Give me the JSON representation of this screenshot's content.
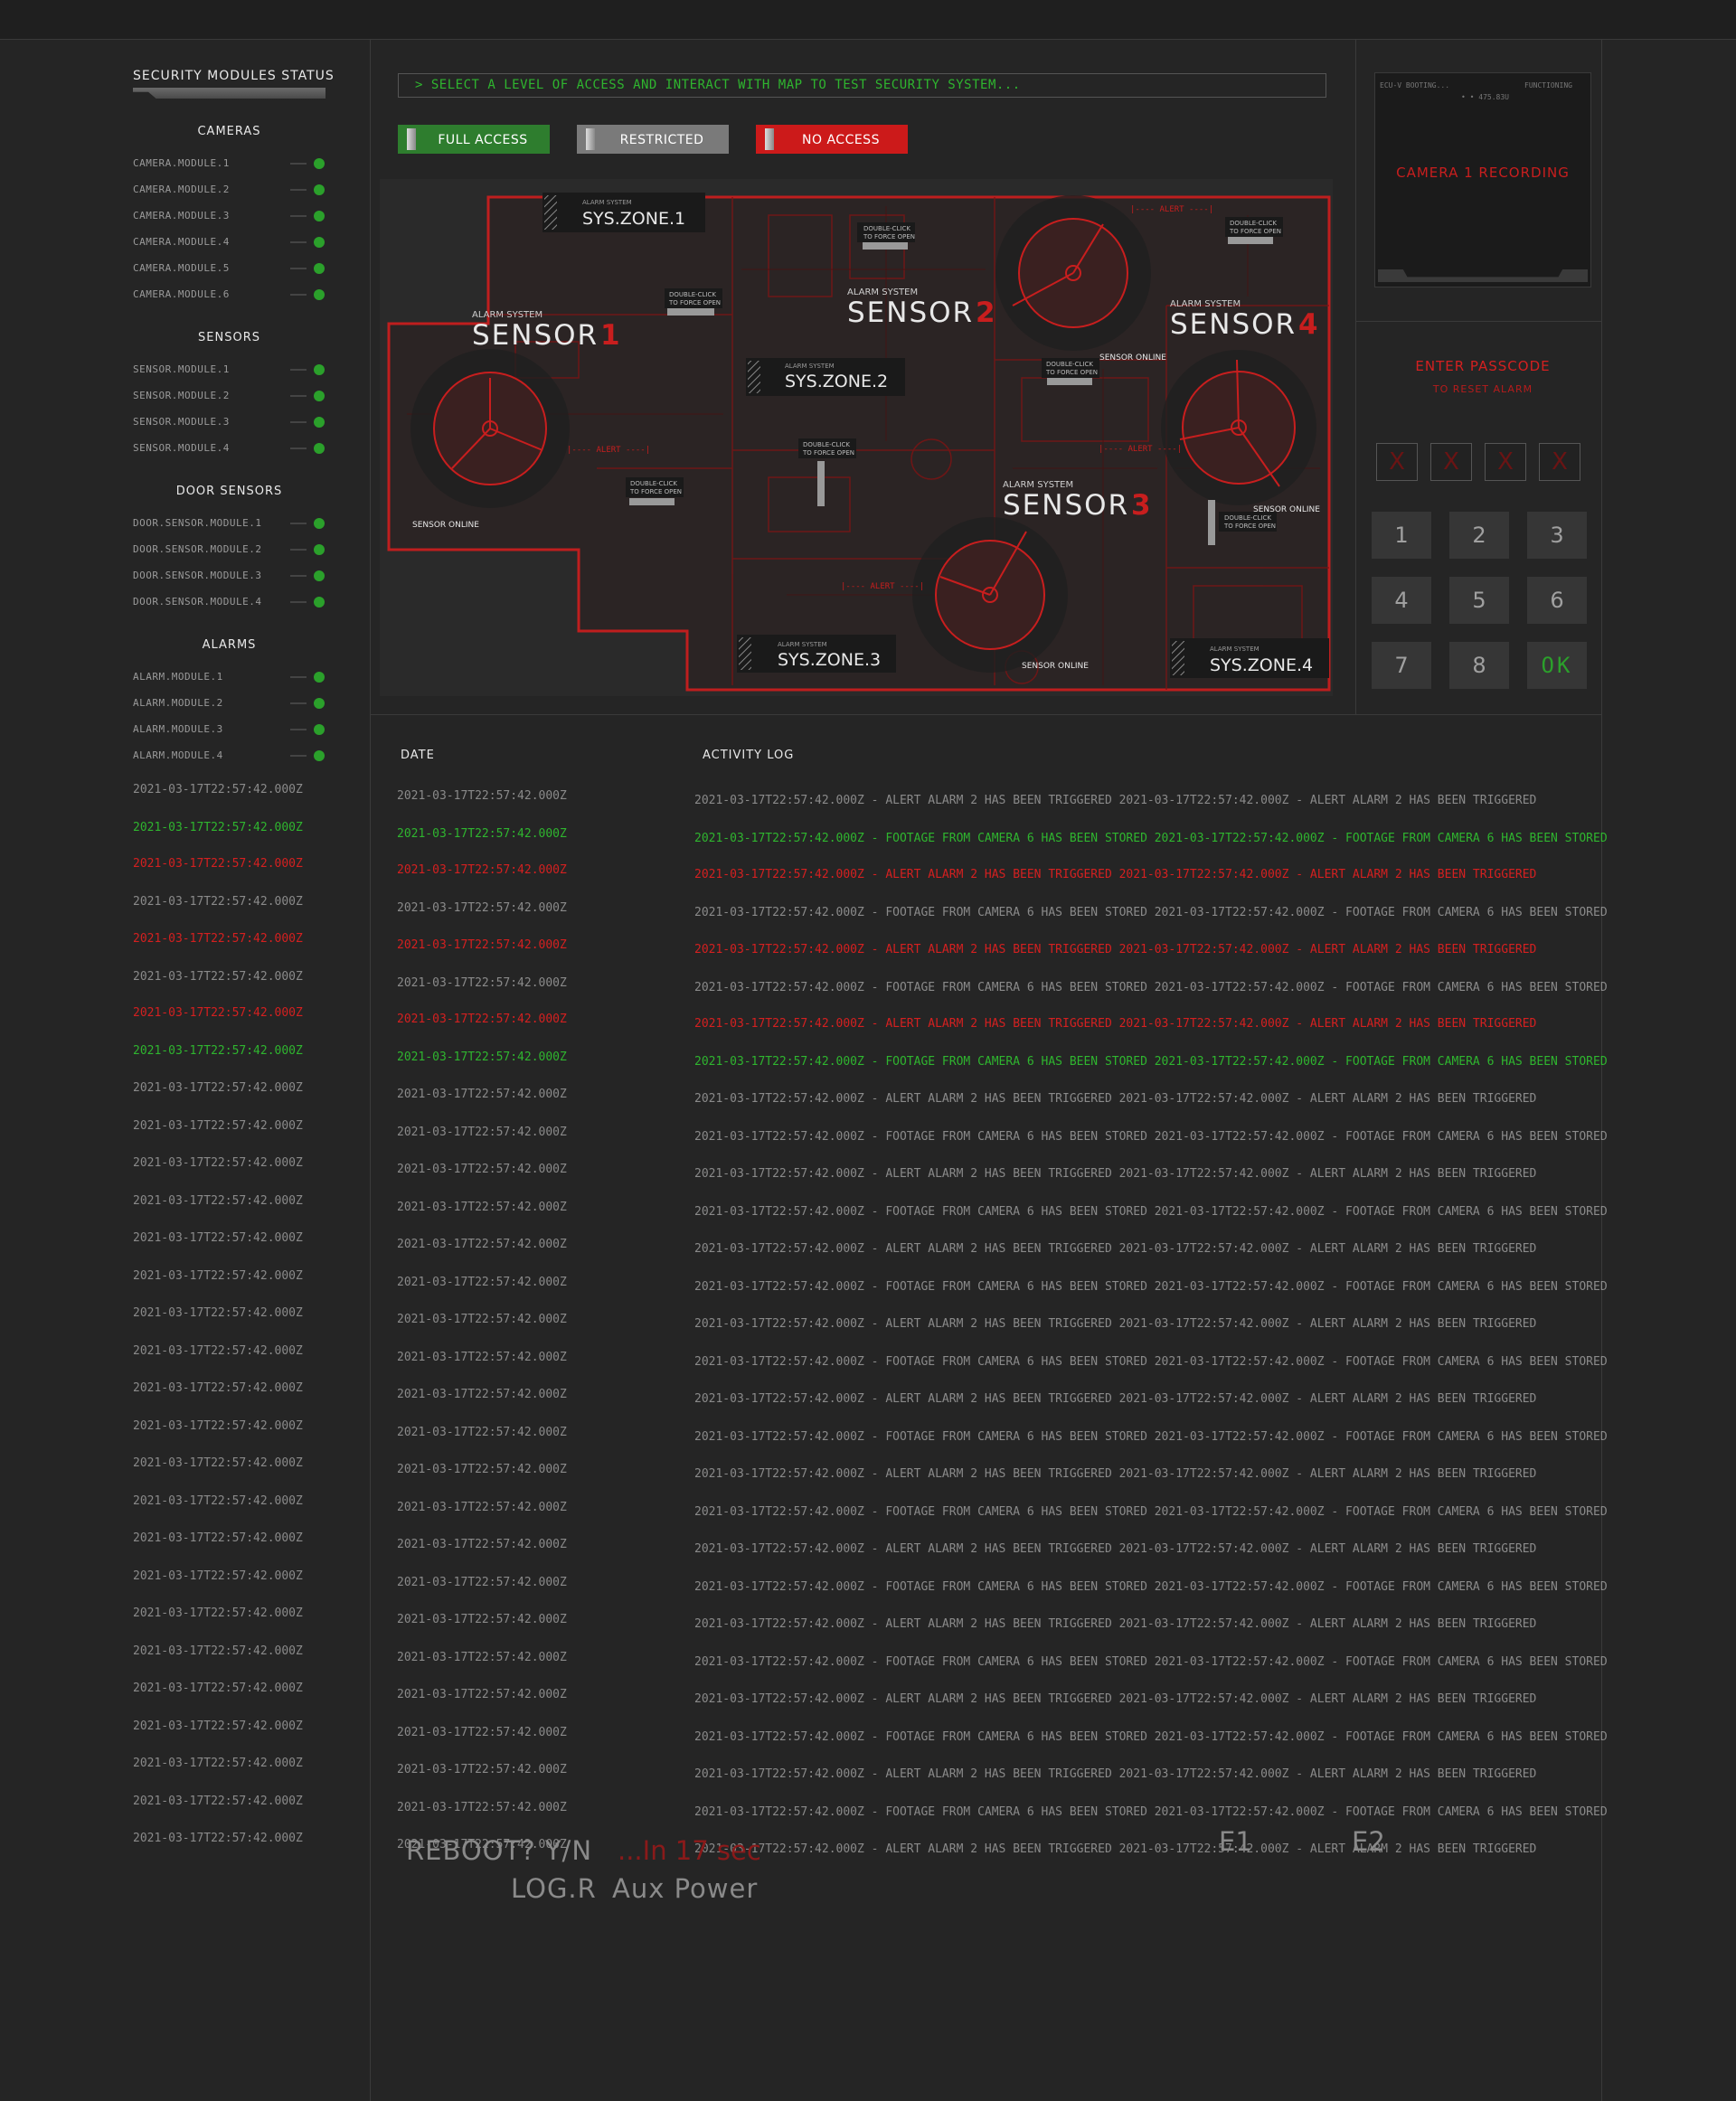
{
  "sidebar": {
    "title": "SECURITY MODULES STATUS",
    "groups": [
      {
        "title": "CAMERAS",
        "items": [
          "CAMERA.MODULE.1",
          "CAMERA.MODULE.2",
          "CAMERA.MODULE.3",
          "CAMERA.MODULE.4",
          "CAMERA.MODULE.5",
          "CAMERA.MODULE.6"
        ]
      },
      {
        "title": "SENSORS",
        "items": [
          "SENSOR.MODULE.1",
          "SENSOR.MODULE.2",
          "SENSOR.MODULE.3",
          "SENSOR.MODULE.4"
        ]
      },
      {
        "title": "DOOR SENSORS",
        "items": [
          "DOOR.SENSOR.MODULE.1",
          "DOOR.SENSOR.MODULE.2",
          "DOOR.SENSOR.MODULE.3",
          "DOOR.SENSOR.MODULE.4"
        ]
      },
      {
        "title": "ALARMS",
        "items": [
          "ALARM.MODULE.1",
          "ALARM.MODULE.2",
          "ALARM.MODULE.3",
          "ALARM.MODULE.4"
        ]
      }
    ],
    "status_color": "#2ba02b",
    "date": "2021-03-17T22:57:42.000Z"
  },
  "instruction": "> SELECT A LEVEL OF ACCESS AND INTERACT WITH MAP TO TEST SECURITY SYSTEM...",
  "access_buttons": [
    {
      "label": "FULL ACCESS",
      "color": "#2e7d2e"
    },
    {
      "label": "RESTRICTED",
      "color": "#7a7a7a"
    },
    {
      "label": "NO ACCESS",
      "color": "#cc1a1a"
    }
  ],
  "map": {
    "zones": [
      "SYS.ZONE.1",
      "SYS.ZONE.2",
      "SYS.ZONE.3",
      "SYS.ZONE.4"
    ],
    "zone_caption": "ALARM SYSTEM",
    "sensor_caption": "ALARM SYSTEM",
    "sensor_word": "SENSOR",
    "sensor_numbers": [
      "1",
      "2",
      "3",
      "4"
    ],
    "sensor_online": "SENSOR ONLINE",
    "double_click": "DOUBLE-CLICK",
    "force_open": "TO FORCE OPEN",
    "alert": "|---- ALERT ----|",
    "accent": "#c81e1e"
  },
  "camera": {
    "status_left": "ECU-V BOOTING...",
    "status_right": "FUNCTIONING",
    "readout": "• • 475.83U",
    "recording": "CAMERA 1 RECORDING"
  },
  "passcode": {
    "title": "ENTER PASSCODE",
    "subtitle": "TO RESET ALARM",
    "slots": [
      "X",
      "X",
      "X",
      "X"
    ],
    "keys": [
      "1",
      "2",
      "3",
      "4",
      "5",
      "6",
      "7",
      "8",
      "OK"
    ]
  },
  "log": {
    "date_header": "DATE",
    "activity_header": "ACTIVITY LOG",
    "rows": [
      {
        "date": "2021-03-17T22:57:42.000Z",
        "text": "2021-03-17T22:57:42.000Z - ALERT ALARM 2 HAS BEEN TRIGGERED 2021-03-17T22:57:42.000Z - ALERT ALARM 2 HAS BEEN TRIGGERED",
        "status": ""
      },
      {
        "date": "2021-03-17T22:57:42.000Z",
        "text": "2021-03-17T22:57:42.000Z - FOOTAGE FROM CAMERA 6 HAS BEEN STORED 2021-03-17T22:57:42.000Z - FOOTAGE FROM CAMERA 6 HAS BEEN STORED",
        "status": "g"
      },
      {
        "date": "2021-03-17T22:57:42.000Z",
        "text": "2021-03-17T22:57:42.000Z - ALERT ALARM 2 HAS BEEN TRIGGERED 2021-03-17T22:57:42.000Z - ALERT ALARM 2 HAS BEEN TRIGGERED",
        "status": "r"
      },
      {
        "date": "2021-03-17T22:57:42.000Z",
        "text": "2021-03-17T22:57:42.000Z - FOOTAGE FROM CAMERA 6 HAS BEEN STORED 2021-03-17T22:57:42.000Z - FOOTAGE FROM CAMERA 6 HAS BEEN STORED",
        "status": ""
      },
      {
        "date": "2021-03-17T22:57:42.000Z",
        "text": "2021-03-17T22:57:42.000Z - ALERT ALARM 2 HAS BEEN TRIGGERED 2021-03-17T22:57:42.000Z - ALERT ALARM 2 HAS BEEN TRIGGERED",
        "status": "r"
      },
      {
        "date": "2021-03-17T22:57:42.000Z",
        "text": "2021-03-17T22:57:42.000Z - FOOTAGE FROM CAMERA 6 HAS BEEN STORED 2021-03-17T22:57:42.000Z - FOOTAGE FROM CAMERA 6 HAS BEEN STORED",
        "status": ""
      },
      {
        "date": "2021-03-17T22:57:42.000Z",
        "text": "2021-03-17T22:57:42.000Z - ALERT ALARM 2 HAS BEEN TRIGGERED 2021-03-17T22:57:42.000Z - ALERT ALARM 2 HAS BEEN TRIGGERED",
        "status": "r"
      },
      {
        "date": "2021-03-17T22:57:42.000Z",
        "text": "2021-03-17T22:57:42.000Z - FOOTAGE FROM CAMERA 6 HAS BEEN STORED 2021-03-17T22:57:42.000Z - FOOTAGE FROM CAMERA 6 HAS BEEN STORED",
        "status": "g"
      },
      {
        "date": "2021-03-17T22:57:42.000Z",
        "text": "2021-03-17T22:57:42.000Z - ALERT ALARM 2 HAS BEEN TRIGGERED 2021-03-17T22:57:42.000Z - ALERT ALARM 2 HAS BEEN TRIGGERED",
        "status": ""
      },
      {
        "date": "2021-03-17T22:57:42.000Z",
        "text": "2021-03-17T22:57:42.000Z - FOOTAGE FROM CAMERA 6 HAS BEEN STORED 2021-03-17T22:57:42.000Z - FOOTAGE FROM CAMERA 6 HAS BEEN STORED",
        "status": ""
      },
      {
        "date": "2021-03-17T22:57:42.000Z",
        "text": "2021-03-17T22:57:42.000Z - ALERT ALARM 2 HAS BEEN TRIGGERED 2021-03-17T22:57:42.000Z - ALERT ALARM 2 HAS BEEN TRIGGERED",
        "status": ""
      },
      {
        "date": "2021-03-17T22:57:42.000Z",
        "text": "2021-03-17T22:57:42.000Z - FOOTAGE FROM CAMERA 6 HAS BEEN STORED 2021-03-17T22:57:42.000Z - FOOTAGE FROM CAMERA 6 HAS BEEN STORED",
        "status": ""
      },
      {
        "date": "2021-03-17T22:57:42.000Z",
        "text": "2021-03-17T22:57:42.000Z - ALERT ALARM 2 HAS BEEN TRIGGERED 2021-03-17T22:57:42.000Z - ALERT ALARM 2 HAS BEEN TRIGGERED",
        "status": ""
      },
      {
        "date": "2021-03-17T22:57:42.000Z",
        "text": "2021-03-17T22:57:42.000Z - FOOTAGE FROM CAMERA 6 HAS BEEN STORED 2021-03-17T22:57:42.000Z - FOOTAGE FROM CAMERA 6 HAS BEEN STORED",
        "status": ""
      },
      {
        "date": "2021-03-17T22:57:42.000Z",
        "text": "2021-03-17T22:57:42.000Z - ALERT ALARM 2 HAS BEEN TRIGGERED 2021-03-17T22:57:42.000Z - ALERT ALARM 2 HAS BEEN TRIGGERED",
        "status": ""
      },
      {
        "date": "2021-03-17T22:57:42.000Z",
        "text": "2021-03-17T22:57:42.000Z - FOOTAGE FROM CAMERA 6 HAS BEEN STORED 2021-03-17T22:57:42.000Z - FOOTAGE FROM CAMERA 6 HAS BEEN STORED",
        "status": ""
      },
      {
        "date": "2021-03-17T22:57:42.000Z",
        "text": "2021-03-17T22:57:42.000Z - ALERT ALARM 2 HAS BEEN TRIGGERED 2021-03-17T22:57:42.000Z - ALERT ALARM 2 HAS BEEN TRIGGERED",
        "status": ""
      },
      {
        "date": "2021-03-17T22:57:42.000Z",
        "text": "2021-03-17T22:57:42.000Z - FOOTAGE FROM CAMERA 6 HAS BEEN STORED 2021-03-17T22:57:42.000Z - FOOTAGE FROM CAMERA 6 HAS BEEN STORED",
        "status": ""
      },
      {
        "date": "2021-03-17T22:57:42.000Z",
        "text": "2021-03-17T22:57:42.000Z - ALERT ALARM 2 HAS BEEN TRIGGERED 2021-03-17T22:57:42.000Z - ALERT ALARM 2 HAS BEEN TRIGGERED",
        "status": ""
      },
      {
        "date": "2021-03-17T22:57:42.000Z",
        "text": "2021-03-17T22:57:42.000Z - FOOTAGE FROM CAMERA 6 HAS BEEN STORED 2021-03-17T22:57:42.000Z - FOOTAGE FROM CAMERA 6 HAS BEEN STORED",
        "status": ""
      },
      {
        "date": "2021-03-17T22:57:42.000Z",
        "text": "2021-03-17T22:57:42.000Z - ALERT ALARM 2 HAS BEEN TRIGGERED 2021-03-17T22:57:42.000Z - ALERT ALARM 2 HAS BEEN TRIGGERED",
        "status": ""
      },
      {
        "date": "2021-03-17T22:57:42.000Z",
        "text": "2021-03-17T22:57:42.000Z - FOOTAGE FROM CAMERA 6 HAS BEEN STORED 2021-03-17T22:57:42.000Z - FOOTAGE FROM CAMERA 6 HAS BEEN STORED",
        "status": ""
      },
      {
        "date": "2021-03-17T22:57:42.000Z",
        "text": "2021-03-17T22:57:42.000Z - ALERT ALARM 2 HAS BEEN TRIGGERED 2021-03-17T22:57:42.000Z - ALERT ALARM 2 HAS BEEN TRIGGERED",
        "status": ""
      },
      {
        "date": "2021-03-17T22:57:42.000Z",
        "text": "2021-03-17T22:57:42.000Z - FOOTAGE FROM CAMERA 6 HAS BEEN STORED 2021-03-17T22:57:42.000Z - FOOTAGE FROM CAMERA 6 HAS BEEN STORED",
        "status": ""
      },
      {
        "date": "2021-03-17T22:57:42.000Z",
        "text": "2021-03-17T22:57:42.000Z - ALERT ALARM 2 HAS BEEN TRIGGERED 2021-03-17T22:57:42.000Z - ALERT ALARM 2 HAS BEEN TRIGGERED",
        "status": ""
      },
      {
        "date": "2021-03-17T22:57:42.000Z",
        "text": "2021-03-17T22:57:42.000Z - FOOTAGE FROM CAMERA 6 HAS BEEN STORED 2021-03-17T22:57:42.000Z - FOOTAGE FROM CAMERA 6 HAS BEEN STORED",
        "status": ""
      },
      {
        "date": "2021-03-17T22:57:42.000Z",
        "text": "2021-03-17T22:57:42.000Z - ALERT ALARM 2 HAS BEEN TRIGGERED 2021-03-17T22:57:42.000Z - ALERT ALARM 2 HAS BEEN TRIGGERED",
        "status": ""
      },
      {
        "date": "2021-03-17T22:57:42.000Z",
        "text": "2021-03-17T22:57:42.000Z - FOOTAGE FROM CAMERA 6 HAS BEEN STORED 2021-03-17T22:57:42.000Z - FOOTAGE FROM CAMERA 6 HAS BEEN STORED",
        "status": ""
      },
      {
        "date": "2021-03-17T22:57:42.000Z",
        "text": "2021-03-17T22:57:42.000Z - ALERT ALARM 2 HAS BEEN TRIGGERED 2021-03-17T22:57:42.000Z - ALERT ALARM 2 HAS BEEN TRIGGERED",
        "status": ""
      }
    ]
  },
  "side_dates": [
    "",
    "g",
    "r",
    "",
    "r",
    "",
    "r",
    "g",
    "",
    "",
    "",
    "",
    "",
    "",
    "",
    "",
    "",
    "",
    "",
    "",
    "",
    "",
    "",
    "",
    "",
    "",
    "",
    "",
    ""
  ],
  "footer": {
    "reboot": "REBOOT? Y/N",
    "countdown": "...In 17 sec",
    "log_r": "LOG.R",
    "aux_power": "Aux Power",
    "e1": "E1",
    "e2": "E2"
  }
}
